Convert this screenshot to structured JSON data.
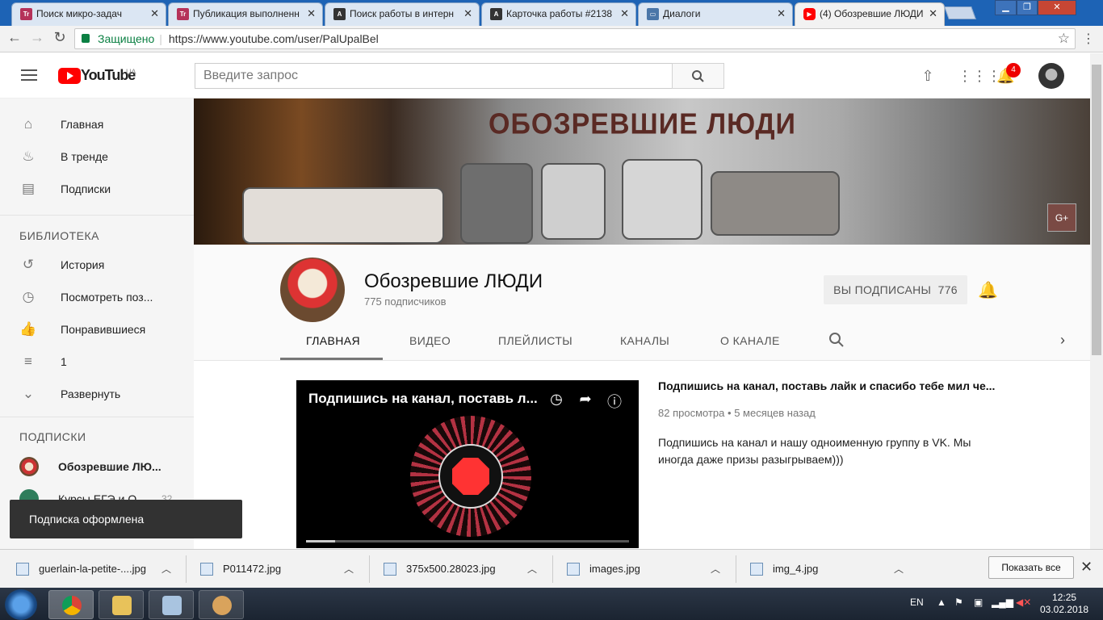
{
  "browser": {
    "tabs": [
      {
        "title": "Поиск микро-задач",
        "favicon": "Tr",
        "color": "#b5325a"
      },
      {
        "title": "Публикация выполненн",
        "favicon": "Tr",
        "color": "#b5325a"
      },
      {
        "title": "Поиск работы в интерн",
        "favicon": "A",
        "color": "#333333"
      },
      {
        "title": "Карточка работы #2138",
        "favicon": "A",
        "color": "#333333"
      },
      {
        "title": "Диалоги",
        "favicon": "chat",
        "color": "#4a76a8"
      },
      {
        "title": "(4) Обозревшие ЛЮДИ",
        "favicon": "yt",
        "color": "#ff0000"
      }
    ],
    "security": "Защищено",
    "url": "https://www.youtube.com/user/PalUpalBel"
  },
  "youtube": {
    "logo": "YouTube",
    "region": "UA",
    "search_placeholder": "Введите запрос",
    "notifications": "4"
  },
  "sidebar": {
    "main": [
      {
        "label": "Главная",
        "icon": "home-icon"
      },
      {
        "label": "В тренде",
        "icon": "fire-icon"
      },
      {
        "label": "Подписки",
        "icon": "subscriptions-icon"
      }
    ],
    "library_header": "БИБЛИОТЕКА",
    "library": [
      {
        "label": "История",
        "icon": "history-icon"
      },
      {
        "label": "Посмотреть поз...",
        "icon": "clock-icon"
      },
      {
        "label": "Понравившиеся",
        "icon": "thumb-up-icon"
      },
      {
        "label": "1",
        "icon": "playlist-icon"
      },
      {
        "label": "Развернуть",
        "icon": "chevron-down-icon"
      }
    ],
    "subs_header": "ПОДПИСКИ",
    "subs": [
      {
        "label": "Обозревшие ЛЮ...",
        "count": ""
      },
      {
        "label": "Курсы ЕГЭ и О...",
        "count": "32"
      }
    ]
  },
  "toast": "Подписка оформлена",
  "banner": {
    "text": "ОБОЗРЕВШИЕ ЛЮДИ",
    "gplus": "G+"
  },
  "channel": {
    "name": "Обозревшие ЛЮДИ",
    "subscribers": "775 подписчиков",
    "subscribed_label": "ВЫ ПОДПИСАНЫ",
    "subscribed_count": "776",
    "tabs": [
      "ГЛАВНАЯ",
      "ВИДЕО",
      "ПЛЕЙЛИСТЫ",
      "КАНАЛЫ",
      "О КАНАЛЕ"
    ]
  },
  "video": {
    "player_title": "Подпишись на канал, поставь л...",
    "title": "Подпишись на канал, поставь лайк и спасибо тебе мил че...",
    "views": "82 просмотра",
    "dot": "•",
    "age": "5 месяцев назад",
    "description": "Подпишись на канал и нашу одноименную группу в VK. Мы иногда даже призы разыгрываем)))",
    "progress": 0.09
  },
  "downloads": {
    "items": [
      "guerlain-la-petite-....jpg",
      "P011472.jpg",
      "375x500.28023.jpg",
      "images.jpg",
      "img_4.jpg"
    ],
    "show_all": "Показать все"
  },
  "taskbar": {
    "lang": "EN",
    "time": "12:25",
    "date": "03.02.2018"
  }
}
